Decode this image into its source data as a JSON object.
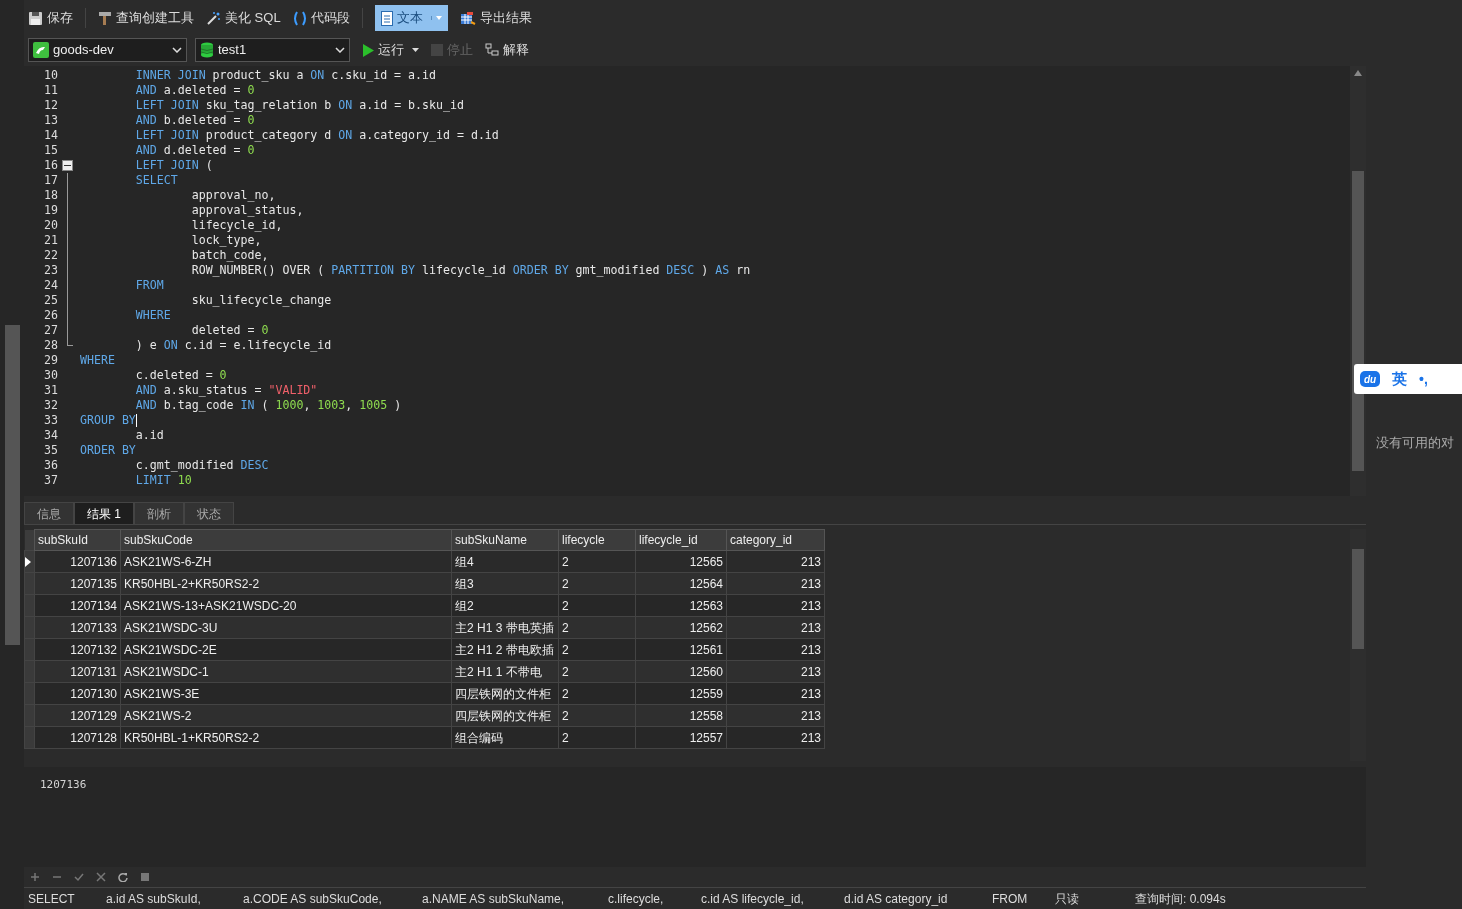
{
  "toolbar": [
    {
      "kind": "save",
      "label": "保存"
    },
    {
      "kind": "builder",
      "label": "查询创建工具"
    },
    {
      "kind": "beautify",
      "label": "美化 SQL"
    },
    {
      "kind": "snippet",
      "label": "代码段"
    },
    {
      "kind": "text",
      "label": "文本",
      "selected": true
    },
    {
      "kind": "export",
      "label": "导出结果"
    }
  ],
  "connection": "goods-dev",
  "database": "test1",
  "actions": [
    {
      "kind": "run",
      "label": "运行",
      "disabled": false
    },
    {
      "kind": "stop",
      "label": "停止",
      "disabled": true
    },
    {
      "kind": "explain",
      "label": "解释",
      "disabled": false
    }
  ],
  "editor": {
    "lines": [
      {
        "n": "10",
        "tokens": [
          {
            "kind": "keyword",
            "text": "        INNER JOIN"
          },
          {
            "kind": "plain",
            "text": " product_sku a "
          },
          {
            "kind": "keyword",
            "text": "ON"
          },
          {
            "kind": "plain",
            "text": " c.sku_id = a.id"
          }
        ]
      },
      {
        "n": "11",
        "tokens": [
          {
            "kind": "keyword",
            "text": "        AND"
          },
          {
            "kind": "plain",
            "text": " a.deleted = "
          },
          {
            "kind": "number",
            "text": "0"
          }
        ]
      },
      {
        "n": "12",
        "tokens": [
          {
            "kind": "keyword",
            "text": "        LEFT JOIN"
          },
          {
            "kind": "plain",
            "text": " sku_tag_relation b "
          },
          {
            "kind": "keyword",
            "text": "ON"
          },
          {
            "kind": "plain",
            "text": " a.id = b.sku_id"
          }
        ]
      },
      {
        "n": "13",
        "tokens": [
          {
            "kind": "keyword",
            "text": "        AND"
          },
          {
            "kind": "plain",
            "text": " b.deleted = "
          },
          {
            "kind": "number",
            "text": "0"
          }
        ]
      },
      {
        "n": "14",
        "tokens": [
          {
            "kind": "keyword",
            "text": "        LEFT JOIN"
          },
          {
            "kind": "plain",
            "text": " product_category d "
          },
          {
            "kind": "keyword",
            "text": "ON"
          },
          {
            "kind": "plain",
            "text": " a.category_id = d.id"
          }
        ]
      },
      {
        "n": "15",
        "tokens": [
          {
            "kind": "keyword",
            "text": "        AND"
          },
          {
            "kind": "plain",
            "text": " d.deleted = "
          },
          {
            "kind": "number",
            "text": "0"
          }
        ]
      },
      {
        "n": "16",
        "expanded": true,
        "tokens": [
          {
            "kind": "keyword",
            "text": "        LEFT JOIN"
          },
          {
            "kind": "plain",
            "text": " ("
          }
        ],
        "children": [
          {
            "n": "17",
            "tokens": [
              {
                "kind": "keyword",
                "text": "        SELECT"
              }
            ]
          },
          {
            "n": "18",
            "tokens": [
              {
                "kind": "plain",
                "text": "                approval_no,"
              }
            ]
          },
          {
            "n": "19",
            "tokens": [
              {
                "kind": "plain",
                "text": "                approval_status,"
              }
            ]
          },
          {
            "n": "20",
            "tokens": [
              {
                "kind": "plain",
                "text": "                lifecycle_id,"
              }
            ]
          },
          {
            "n": "21",
            "tokens": [
              {
                "kind": "plain",
                "text": "                lock_type,"
              }
            ]
          },
          {
            "n": "22",
            "tokens": [
              {
                "kind": "plain",
                "text": "                batch_code,"
              }
            ]
          },
          {
            "n": "23",
            "tokens": [
              {
                "kind": "plain",
                "text": "                ROW_NUMBER() OVER ( "
              },
              {
                "kind": "keyword",
                "text": "PARTITION BY"
              },
              {
                "kind": "plain",
                "text": " lifecycle_id "
              },
              {
                "kind": "keyword",
                "text": "ORDER BY"
              },
              {
                "kind": "plain",
                "text": " gmt_modified "
              },
              {
                "kind": "keyword",
                "text": "DESC"
              },
              {
                "kind": "plain",
                "text": " ) "
              },
              {
                "kind": "keyword",
                "text": "AS"
              },
              {
                "kind": "plain",
                "text": " rn"
              }
            ]
          },
          {
            "n": "24",
            "tokens": [
              {
                "kind": "keyword",
                "text": "        FROM"
              }
            ]
          },
          {
            "n": "25",
            "tokens": [
              {
                "kind": "plain",
                "text": "                sku_lifecycle_change"
              }
            ]
          },
          {
            "n": "26",
            "tokens": [
              {
                "kind": "keyword",
                "text": "        WHERE"
              }
            ]
          },
          {
            "n": "27",
            "tokens": [
              {
                "kind": "plain",
                "text": "                deleted = "
              },
              {
                "kind": "number",
                "text": "0"
              }
            ]
          },
          {
            "n": "28",
            "tokens": [
              {
                "kind": "plain",
                "text": "        ) e "
              },
              {
                "kind": "keyword",
                "text": "ON"
              },
              {
                "kind": "plain",
                "text": " c.id = e.lifecycle_id"
              }
            ]
          }
        ]
      },
      {
        "n": "29",
        "tokens": [
          {
            "kind": "keyword",
            "text": "WHERE"
          }
        ]
      },
      {
        "n": "30",
        "tokens": [
          {
            "kind": "plain",
            "text": "        c.deleted = "
          },
          {
            "kind": "number",
            "text": "0"
          }
        ]
      },
      {
        "n": "31",
        "tokens": [
          {
            "kind": "keyword",
            "text": "        AND"
          },
          {
            "kind": "plain",
            "text": " a.sku_status = "
          },
          {
            "kind": "string",
            "text": "\"VALID\""
          }
        ]
      },
      {
        "n": "32",
        "tokens": [
          {
            "kind": "keyword",
            "text": "        AND"
          },
          {
            "kind": "plain",
            "text": " b.tag_code "
          },
          {
            "kind": "keyword",
            "text": "IN"
          },
          {
            "kind": "plain",
            "text": " ( "
          },
          {
            "kind": "number",
            "text": "1000"
          },
          {
            "kind": "plain",
            "text": ", "
          },
          {
            "kind": "number",
            "text": "1003"
          },
          {
            "kind": "plain",
            "text": ", "
          },
          {
            "kind": "number",
            "text": "1005"
          },
          {
            "kind": "plain",
            "text": " )"
          }
        ]
      },
      {
        "n": "33",
        "cursor": true,
        "tokens": [
          {
            "kind": "keyword",
            "text": "GROUP BY"
          }
        ]
      },
      {
        "n": "34",
        "tokens": [
          {
            "kind": "plain",
            "text": "        a.id"
          }
        ]
      },
      {
        "n": "35",
        "tokens": [
          {
            "kind": "keyword",
            "text": "ORDER BY"
          }
        ]
      },
      {
        "n": "36",
        "tokens": [
          {
            "kind": "plain",
            "text": "        c.gmt_modified "
          },
          {
            "kind": "keyword",
            "text": "DESC"
          }
        ]
      },
      {
        "n": "37",
        "tokens": [
          {
            "kind": "keyword",
            "text": "        LIMIT"
          },
          {
            "kind": "number",
            "text": " 10"
          }
        ]
      }
    ]
  },
  "result_tabs": [
    {
      "label": "信息",
      "selected": false
    },
    {
      "label": "结果 1",
      "selected": true
    },
    {
      "label": "剖析",
      "selected": false
    },
    {
      "label": "状态",
      "selected": false
    }
  ],
  "table": {
    "columns": [
      {
        "label": "subSkuId",
        "right_aligned": true
      },
      {
        "label": "subSkuCode",
        "right_aligned": false
      },
      {
        "label": "subSkuName",
        "right_aligned": false
      },
      {
        "label": "lifecycle",
        "right_aligned": false
      },
      {
        "label": "lifecycle_id",
        "right_aligned": true
      },
      {
        "label": "category_id",
        "right_aligned": true
      }
    ],
    "rows": [
      {
        "selected": true,
        "cells": [
          "1207136",
          "ASK21WS-6-ZH",
          "组4",
          "2",
          "12565",
          "213"
        ]
      },
      {
        "selected": false,
        "cells": [
          "1207135",
          "KR50HBL-2+KR50RS2-2",
          "组3",
          "2",
          "12564",
          "213"
        ]
      },
      {
        "selected": false,
        "cells": [
          "1207134",
          "ASK21WS-13+ASK21WSDC-20",
          "组2",
          "2",
          "12563",
          "213"
        ]
      },
      {
        "selected": false,
        "cells": [
          "1207133",
          "ASK21WSDC-3U",
          "主2 H1 3 带电英插",
          "2",
          "12562",
          "213"
        ]
      },
      {
        "selected": false,
        "cells": [
          "1207132",
          "ASK21WSDC-2E",
          "主2 H1 2 带电欧插",
          "2",
          "12561",
          "213"
        ]
      },
      {
        "selected": false,
        "cells": [
          "1207131",
          "ASK21WSDC-1",
          "主2 H1 1 不带电",
          "2",
          "12560",
          "213"
        ]
      },
      {
        "selected": false,
        "cells": [
          "1207130",
          "ASK21WS-3E",
          "四层铁网的文件柜",
          "2",
          "12559",
          "213"
        ]
      },
      {
        "selected": false,
        "cells": [
          "1207129",
          "ASK21WS-2",
          "四层铁网的文件柜",
          "2",
          "12558",
          "213"
        ]
      },
      {
        "selected": false,
        "cells": [
          "1207128",
          "KR50HBL-1+KR50RS2-2",
          "组合编码",
          "2",
          "12557",
          "213"
        ]
      }
    ]
  },
  "cell_value": "1207136",
  "record_buttons": [
    {
      "kind": "add"
    },
    {
      "kind": "delete"
    },
    {
      "kind": "apply"
    },
    {
      "kind": "discard"
    },
    {
      "kind": "refresh"
    },
    {
      "kind": "stop"
    }
  ],
  "status_bar": [
    "SELECT",
    "a.id AS subSkuId,",
    "a.CODE AS subSkuCode,",
    "a.NAME AS subSkuName,",
    "c.lifecycle,",
    "c.id AS lifecycle_id,",
    "d.id AS category_id",
    "FROM",
    "只读",
    "查询时间: 0.094s"
  ],
  "ime": {
    "logo": "du",
    "lang": "英",
    "punct": "•,"
  },
  "side_note": "没有可用的对"
}
